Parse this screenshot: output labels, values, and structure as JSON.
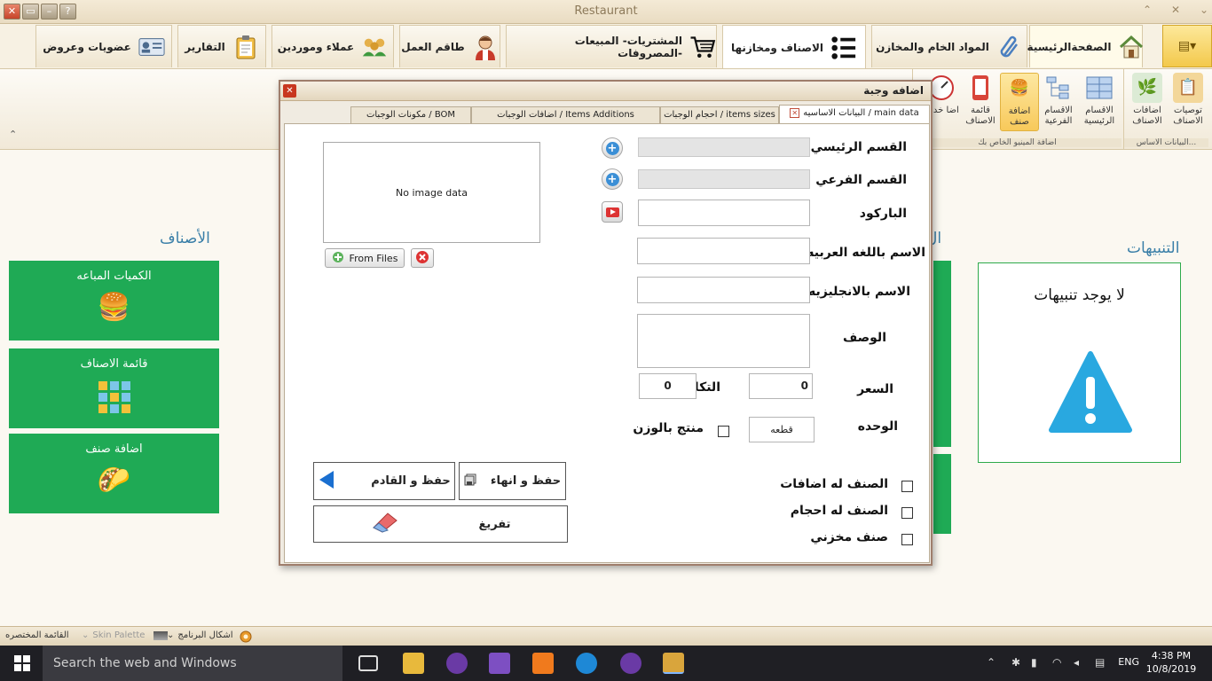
{
  "window": {
    "title": "Restaurant"
  },
  "tabs": [
    {
      "label": "الصفحةالرئيسية",
      "icon": "house-icon"
    },
    {
      "label": "المواد الخام والمخازن",
      "icon": "paperclip-icon"
    },
    {
      "label": "الاصناف ومخازنها",
      "icon": "list-icon"
    },
    {
      "label": "المشتريات- المبيعات -المصروفات",
      "icon": "cart-icon"
    },
    {
      "label": "طاقم العمل",
      "icon": "chef-icon"
    },
    {
      "label": "عملاء وموردين",
      "icon": "people-icon"
    },
    {
      "label": "التقارير",
      "icon": "clipboard-icon"
    },
    {
      "label": "عضويات وعروض",
      "icon": "id-card-icon"
    }
  ],
  "ribbon": {
    "groups": [
      {
        "label": "البيانات الاساس...",
        "buttons": [
          "توصيات الاصناف",
          "اضافات الاصناف"
        ]
      },
      {
        "label": "اضافة المينيو الخاص بك",
        "buttons": [
          "الاقسام الرئيسية",
          "الاقسام الفرعية",
          "اضافة صنف",
          "قائمة الاصناف",
          "اضا خدمة"
        ]
      }
    ]
  },
  "main": {
    "items_title": "الأصناف",
    "tiles": [
      {
        "label": "الكميات المباعه",
        "icon": "burger-icon"
      },
      {
        "label": "قائمة الاصناف",
        "icon": "grid-icon"
      },
      {
        "label": "اضافة صنف",
        "icon": "taco-icon"
      }
    ],
    "alerts_title": "التنبيهات",
    "alerts_message": "لا يوجد تنبيهات",
    "partial_title": "ال"
  },
  "dialog": {
    "title": "اضافه وجبة",
    "tabs": [
      "البيانات الاساسيه / main data",
      "احجام الوجبات / items sizes",
      "اضافات الوجبات / Items Additions",
      "مكونات الوجبات / BOM"
    ],
    "labels": {
      "main_category": "القسم الرئيسي",
      "sub_category": "القسم الفرعي",
      "barcode": "الباركود",
      "name_ar": "الاسم باللغه العربيه",
      "name_en": "الاسم بالانجليزيه",
      "description": "الوصف",
      "price": "السعر",
      "cost": "التكلفه",
      "unit": "الوحده",
      "weight_product": "منتج بالوزن",
      "has_additions": "الصنف له اضافات",
      "has_sizes": "الصنف له احجام",
      "stock_item": "صنف مخزني"
    },
    "values": {
      "price": "0",
      "cost": "0",
      "unit": "قطعه"
    },
    "image_placeholder": "No image data",
    "from_files": "From Files",
    "buttons": {
      "save_close": "حفظ و انهاء",
      "save_next": "حفظ و القادم",
      "clear": "تفريغ"
    }
  },
  "statusbar": {
    "quick_menu": "القائمة المختصره",
    "skin_palette": "Skin Palette",
    "program_skins": "اشكال البرنامج"
  },
  "taskbar": {
    "search_placeholder": "Search the web and Windows",
    "language": "ENG",
    "time": "4:38 PM",
    "date": "10/8/2019"
  }
}
